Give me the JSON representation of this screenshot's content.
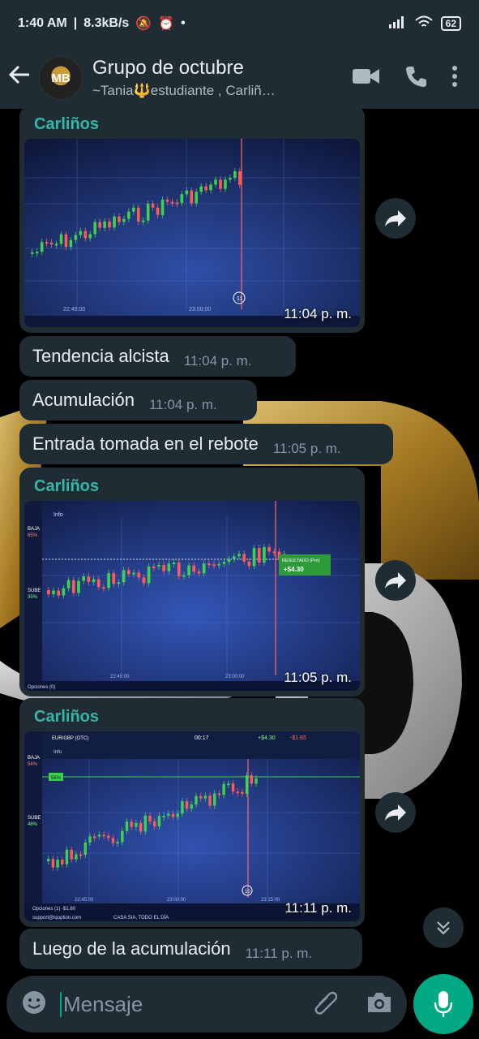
{
  "status_bar": {
    "time": "1:40 AM",
    "speed": "8.3kB/s",
    "battery": "62"
  },
  "header": {
    "back_icon": "arrow-left-icon",
    "avatar_text": "MB",
    "title": "Grupo de octubre",
    "subtitle": "~Tania🔱estudiante , Carliñ…"
  },
  "messages": [
    {
      "type": "image",
      "sender": "Carliños",
      "time": "11:04 p. m."
    },
    {
      "type": "text",
      "text": "Tendencia alcista",
      "time": "11:04 p. m."
    },
    {
      "type": "text",
      "text": "Acumulación",
      "time": "11:04 p. m."
    },
    {
      "type": "text",
      "text": "Entrada tomada en el rebote",
      "time": "11:05 p. m."
    },
    {
      "type": "image",
      "sender": "Carliños",
      "time": "11:05 p. m."
    },
    {
      "type": "image",
      "sender": "Carliños",
      "time": "11:11 p. m."
    },
    {
      "type": "text",
      "text": "Luego de la acumulación",
      "time": "11:11 p. m."
    }
  ],
  "screenshots": {
    "s1": {
      "x1": "22:45:00",
      "x2": "23:00:00",
      "badge": "11"
    },
    "s2": {
      "info": "Info",
      "baja": "BAJA",
      "baja_pct": "65%",
      "sube": "SUBE",
      "sube_pct": "35%",
      "result_label": "RESULTADO (Pro)",
      "result_value": "+$4.30",
      "x1": "22:45:00",
      "x2": "23:00:00",
      "options": "Opciones (0)"
    },
    "s3": {
      "pair": "EUR/GBP (OTC)",
      "info": "Info",
      "timer": "00:17",
      "profit": "+$4.30",
      "loss": "-$1.65",
      "baja": "BAJA",
      "baja_pct": "54%",
      "sube": "SUBE",
      "sube_pct": "46%",
      "flag": "56%",
      "x1": "22:45:00",
      "x2": "23:00:00",
      "x3": "23:15:00",
      "options": "Opciones (1) -$1.80",
      "support": "support@iqoption.com",
      "footer": "CASA SIA, TODO EL DÍA",
      "badge": "10"
    }
  },
  "input": {
    "placeholder": "Mensaje"
  },
  "colors": {
    "bubble": "#1f2c34",
    "accent": "#00a884",
    "sender": "#34b7a7"
  }
}
